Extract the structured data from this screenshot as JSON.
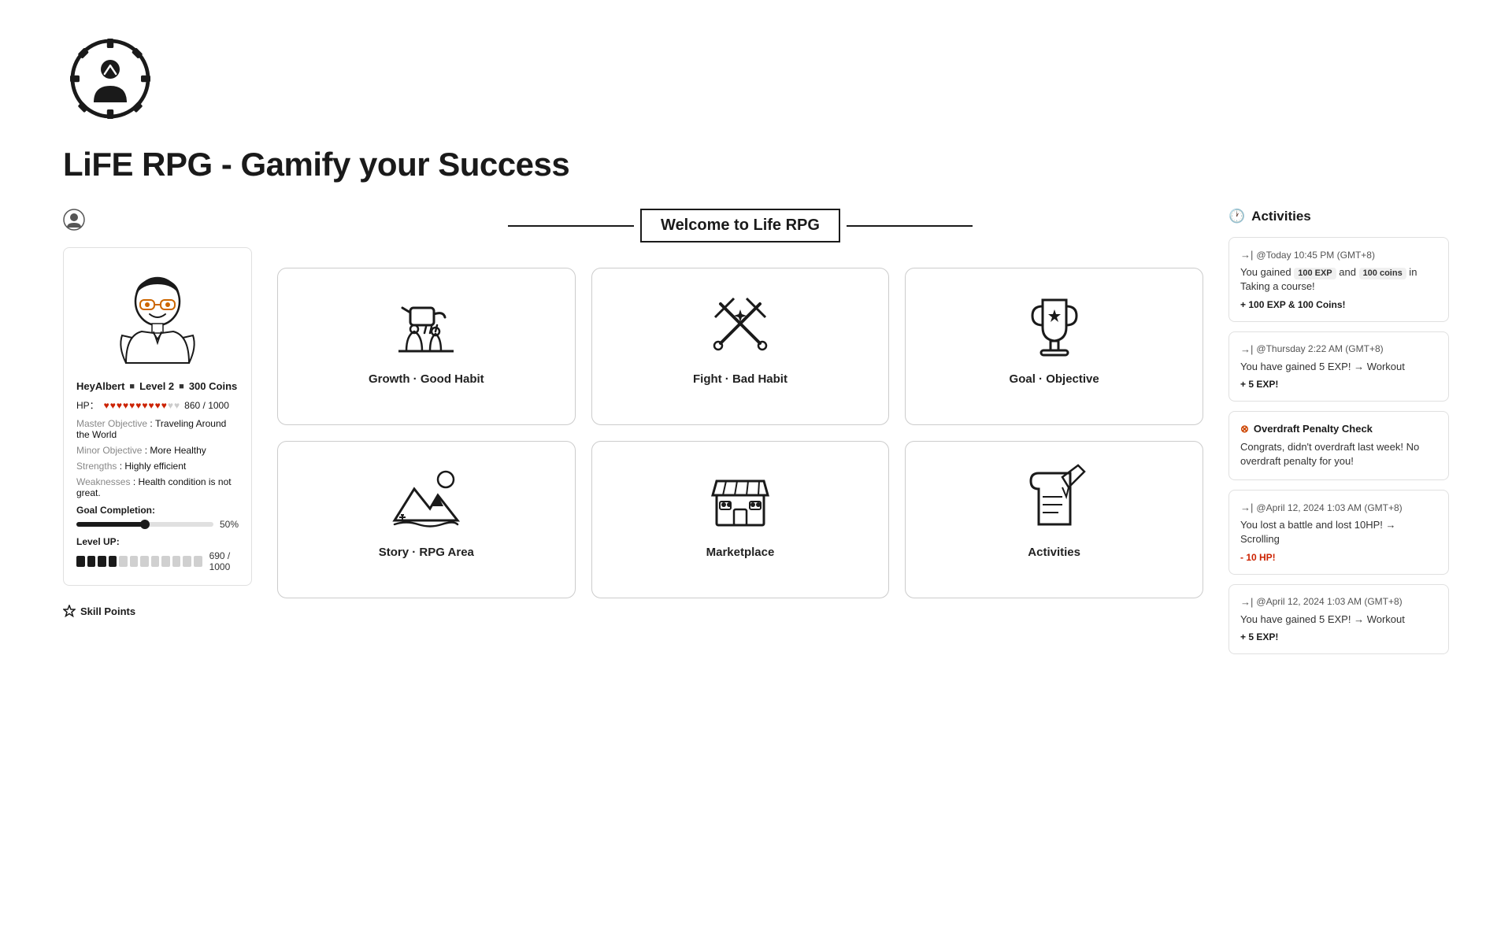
{
  "app": {
    "title": "LiFE RPG - Gamify your Success"
  },
  "welcome": {
    "banner": "Welcome to Life RPG"
  },
  "character": {
    "name": "HeyAlbert",
    "level": "Level 2",
    "coins": "300 Coins",
    "hp_current": 860,
    "hp_max": 1000,
    "hp_full_hearts": 10,
    "hp_empty_hearts": 2,
    "master_objective_label": "Master Objective",
    "master_objective": "Traveling Around the World",
    "minor_objective_label": "Minor Objective",
    "minor_objective": "More Healthy",
    "strengths_label": "Strengths",
    "strengths": "Highly efficient",
    "weaknesses_label": "Weaknesses",
    "weaknesses": "Health condition is not great.",
    "goal_completion_label": "Goal Completion:",
    "goal_completion_pct": 50,
    "level_up_label": "Level UP:",
    "level_current": 690,
    "level_max": 1000,
    "level_filled": 4,
    "level_empty": 8
  },
  "skill_points_label": "Skill Points",
  "cards": [
    {
      "id": "growth-good-habit",
      "label": "Growth · Good Habit",
      "icon_type": "plant"
    },
    {
      "id": "fight-bad-habit",
      "label": "Fight · Bad Habit",
      "icon_type": "swords"
    },
    {
      "id": "goal-objective",
      "label": "Goal · Objective",
      "icon_type": "trophy"
    },
    {
      "id": "story-rpg-area",
      "label": "Story · RPG Area",
      "icon_type": "mountain"
    },
    {
      "id": "marketplace",
      "label": "Marketplace",
      "icon_type": "store"
    },
    {
      "id": "activities",
      "label": "Activities",
      "icon_type": "pen"
    }
  ],
  "activities_section": {
    "title": "Activities",
    "items": [
      {
        "timestamp": "@Today 10:45 PM (GMT+8)",
        "body_pre": "You gained ",
        "exp_badge": "100 EXP",
        "body_mid": " and ",
        "coins_badge": "100 coins",
        "body_post": " in Taking a course!",
        "reward": "+ 100 EXP & 100 Coins!"
      },
      {
        "timestamp": "@Thursday 2:22 AM (GMT+8)",
        "body": "You have gained 5 EXP! → Workout",
        "reward": "+ 5 EXP!"
      }
    ],
    "penalty": {
      "title": "Overdraft Penalty Check",
      "body": "Congrats, didn't overdraft last week! No overdraft penalty for you!"
    },
    "older_items": [
      {
        "timestamp": "@April 12, 2024 1:03 AM (GMT+8)",
        "body": "You lost a battle and lost 10HP! → Scrolling",
        "reward": "- 10 HP!",
        "reward_type": "negative"
      },
      {
        "timestamp": "@April 12, 2024 1:03 AM (GMT+8)",
        "body": "You have gained 5 EXP! → Workout",
        "reward": "+ 5 EXP!"
      }
    ]
  }
}
